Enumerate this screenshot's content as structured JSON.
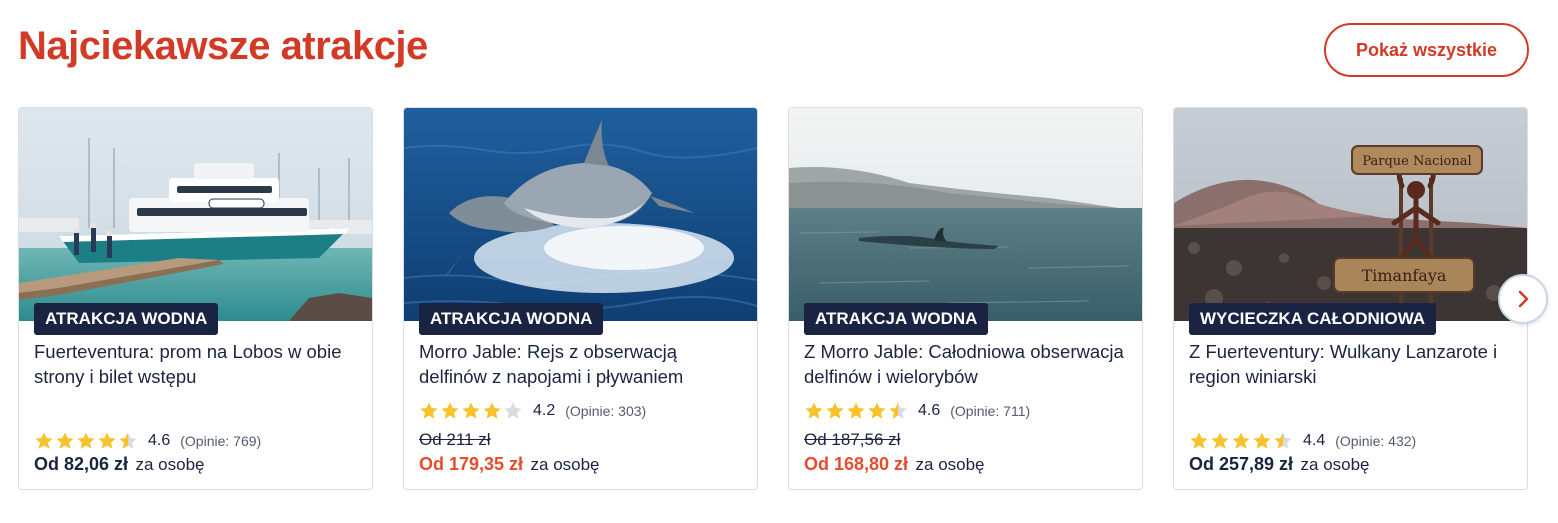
{
  "section": {
    "title": "Najciekawsze atrakcje",
    "show_all_label": "Pokaż wszystkie"
  },
  "colors": {
    "brand": "#d33a25",
    "sale": "#e54d2e",
    "badge": "#1a2342",
    "star": "#f7c22b",
    "star_empty": "#d9dbe1"
  },
  "cards": [
    {
      "badge": "ATRAKCJA WODNA",
      "title": "Fuerteventura: prom na Lobos w obie strony i bilet wstępu",
      "rating": "4.6",
      "rating_stars": 4.5,
      "reviews": "(Opinie: 769)",
      "old_price": "",
      "price": "Od 82,06 zł",
      "per_person": "za osobę",
      "image_icon": "ferry-boat-image"
    },
    {
      "badge": "ATRAKCJA WODNA",
      "title": "Morro Jable: Rejs z obserwacją delfinów z napojami i pływaniem",
      "rating": "4.2",
      "rating_stars": 4,
      "reviews": "(Opinie: 303)",
      "old_price": "Od 211 zł",
      "price": "Od 179,35 zł",
      "per_person": "za osobę",
      "image_icon": "dolphins-image"
    },
    {
      "badge": "ATRAKCJA WODNA",
      "title": "Z Morro Jable: Całodniowa obserwacja delfinów i wielorybów",
      "rating": "4.6",
      "rating_stars": 4.5,
      "reviews": "(Opinie: 711)",
      "old_price": "Od 187,56 zł",
      "price": "Od 168,80 zł",
      "per_person": "za osobę",
      "image_icon": "whale-fin-image"
    },
    {
      "badge": "WYCIECZKA CAŁODNIOWA",
      "title": "Z Fuerteventury: Wulkany Lanzarote i region winiarski",
      "rating": "4.4",
      "rating_stars": 4.5,
      "reviews": "(Opinie: 432)",
      "old_price": "",
      "price": "Od 257,89 zł",
      "per_person": "za osobę",
      "image_icon": "volcano-park-sign-image",
      "image_text": "Parque Nacional Timanfaya"
    }
  ],
  "carousel": {
    "next_icon": "chevron-right-icon"
  }
}
